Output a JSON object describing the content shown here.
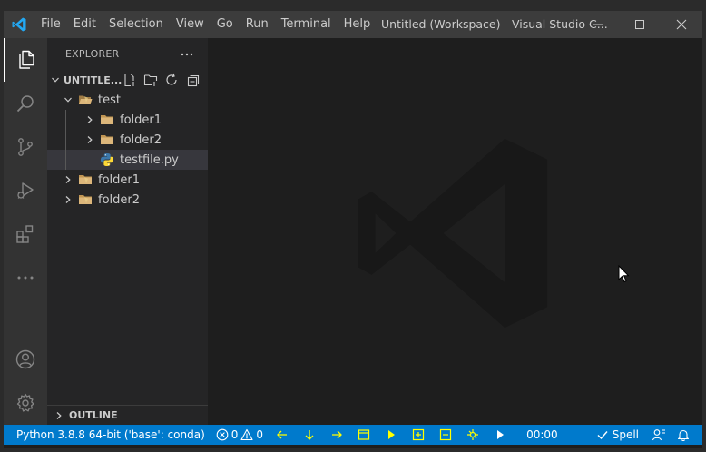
{
  "titlebar": {
    "menu": [
      "File",
      "Edit",
      "Selection",
      "View",
      "Go",
      "Run",
      "Terminal",
      "Help"
    ],
    "title": "Untitled (Workspace) - Visual Studio C..."
  },
  "sidebar": {
    "header": "EXPLORER",
    "workspace_title": "UNTITLE...",
    "tree": [
      {
        "label": "test",
        "depth": 0,
        "type": "folder-open"
      },
      {
        "label": "folder1",
        "depth": 1,
        "type": "folder"
      },
      {
        "label": "folder2",
        "depth": 1,
        "type": "folder"
      },
      {
        "label": "testfile.py",
        "depth": 1,
        "type": "python-file",
        "selected": true
      },
      {
        "label": "folder1",
        "depth": 0,
        "type": "folder"
      },
      {
        "label": "folder2",
        "depth": 0,
        "type": "folder"
      }
    ],
    "outline": "OUTLINE"
  },
  "statusbar": {
    "python": "Python 3.8.8 64-bit ('base': conda)",
    "errors": "0",
    "warnings": "0",
    "timer": "00:00",
    "spell": "Spell"
  },
  "colors": {
    "statusbar": "#007acc",
    "titlebar": "#3c3c3c",
    "activitybar": "#333333",
    "sidebar": "#252526",
    "editor": "#1e1e1e",
    "folder": "#c09553",
    "accent_blue": "#23a8f2"
  }
}
